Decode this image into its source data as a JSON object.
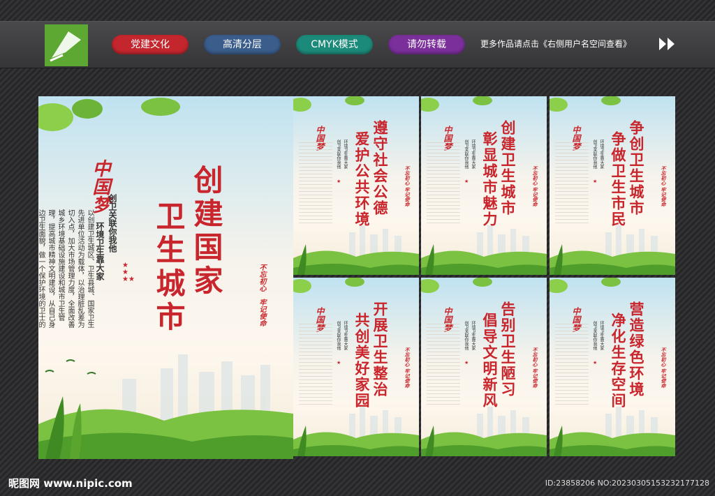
{
  "header": {
    "tags": [
      {
        "label": "党建文化",
        "color": "#c4262e"
      },
      {
        "label": "高清分层",
        "color": "#3a5d8c"
      },
      {
        "label": "CMYK模式",
        "color": "#1c8a7a"
      },
      {
        "label": "请勿转载",
        "color": "#7a2f9a"
      }
    ],
    "notice": "更多作品请点击《右侧用户名空间查看》"
  },
  "main_poster": {
    "title": [
      "创建国家",
      "卫生城市"
    ],
    "dream_logo": "中国梦",
    "subtitle": [
      "创卫关联你我他",
      "环境卫生靠大家"
    ],
    "body": [
      "以创建卫生城区、卫生县城、国家卫生先进单位",
      "活动为载体，以治理脏乱差为切入点，加大市场",
      "管理力度，全面改善城乡环境",
      "基础设施建设和城市卫生",
      "管理，提高城市精神文明建设，从自己身边",
      "卫生面貌，做一个保护环境的卫士",
      "的小事做起"
    ],
    "stamp": [
      "不忘初心",
      "牢记使命"
    ]
  },
  "posters": [
    {
      "line1": "遵守社会公德",
      "line2": "爱护公共环境"
    },
    {
      "line1": "创建卫生城市",
      "line2": "彰显城市魅力"
    },
    {
      "line1": "争创卫生城市",
      "line2": "争做卫生市民"
    },
    {
      "line1": "开展卫生整治",
      "line2": "共创美好家园"
    },
    {
      "line1": "告别卫生陋习",
      "line2": "倡导文明新风"
    },
    {
      "line1": "营造绿色环境",
      "line2": "净化生存空间"
    }
  ],
  "poster_small": [
    "创卫关联你我他",
    "环境卫生靠大家"
  ],
  "poster_stamp": "不忘初心 牢记使命",
  "footer": {
    "site": "昵图网 www.nipic.com",
    "id": "ID:23858206 NO:20230305153232177128"
  }
}
